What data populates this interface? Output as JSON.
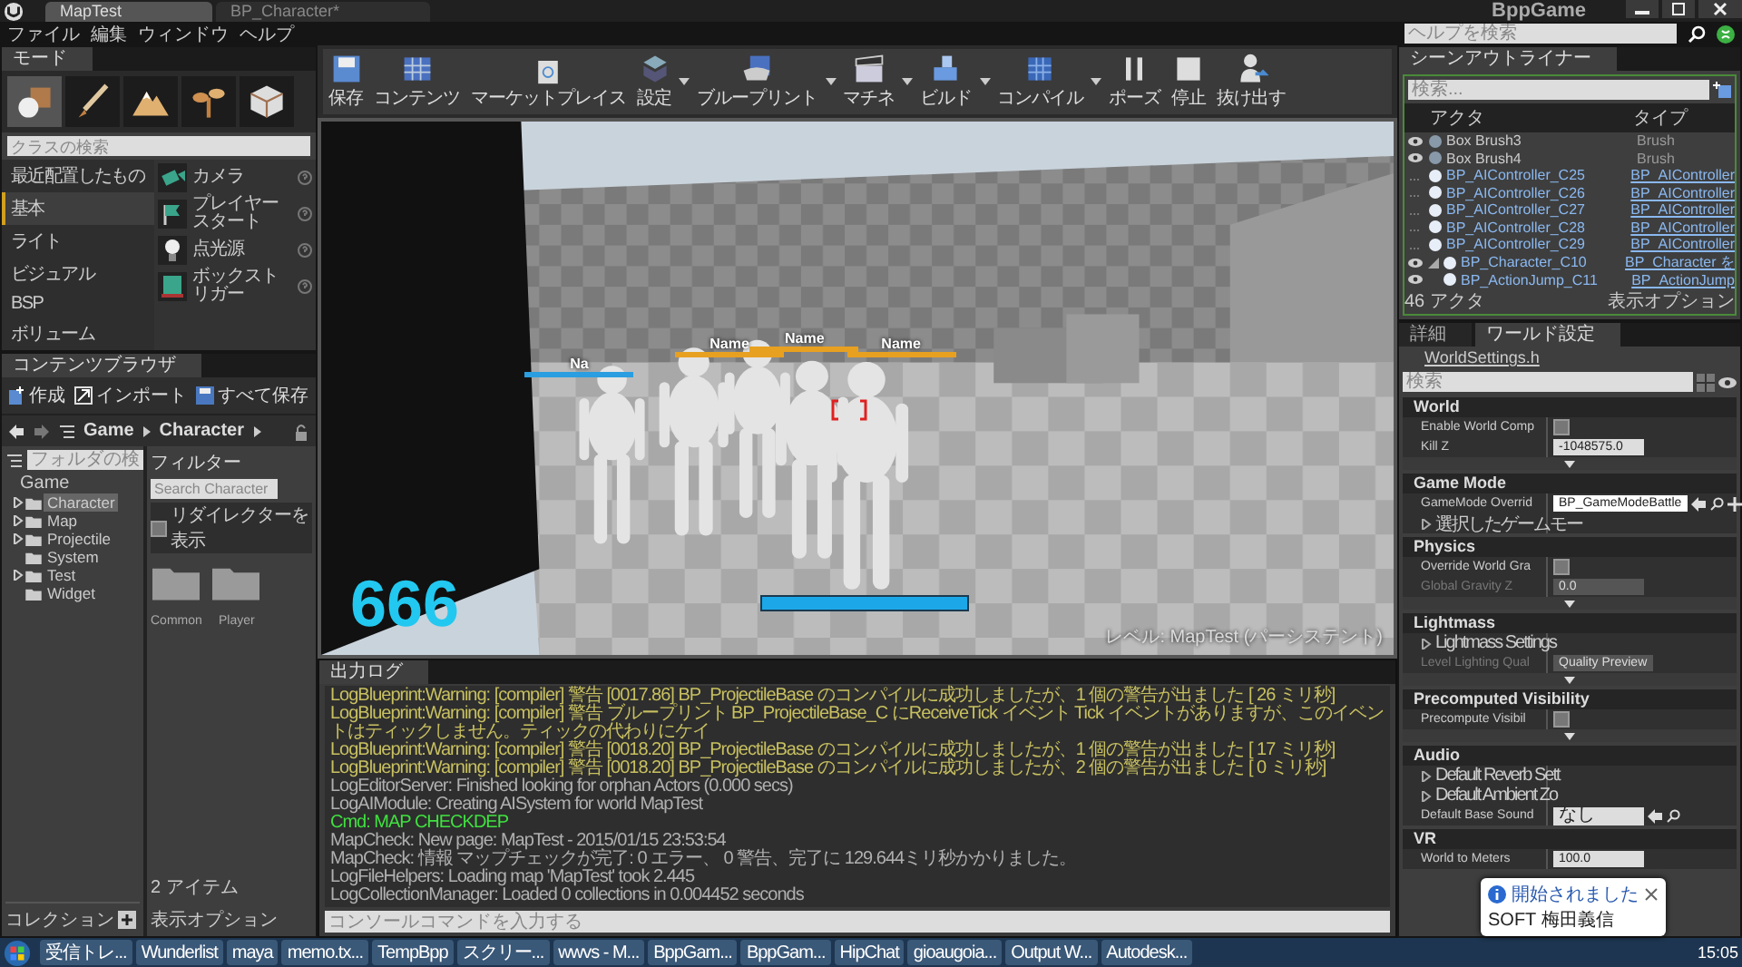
{
  "window": {
    "title": "BppGame",
    "tabs": [
      {
        "label": "MapTest",
        "selected": true
      },
      {
        "label": "BP_Character*",
        "selected": false
      }
    ]
  },
  "menu": [
    "ファイル",
    "編集",
    "ウィンドウ",
    "ヘルプ"
  ],
  "help_search": {
    "placeholder": "ヘルプを検索"
  },
  "modes": {
    "tab": "モード",
    "tools": [
      {
        "kind": "place",
        "selected": true
      },
      {
        "kind": "paint",
        "selected": false
      },
      {
        "kind": "landscape",
        "selected": false
      },
      {
        "kind": "foliage",
        "selected": false
      },
      {
        "kind": "geometry",
        "selected": false
      }
    ],
    "search": {
      "placeholder": "クラスの検索"
    },
    "categories": [
      {
        "label": "最近配置したもの",
        "selected": false
      },
      {
        "label": "基本",
        "selected": true
      },
      {
        "label": "ライト",
        "selected": false
      },
      {
        "label": "ビジュアル",
        "selected": false
      },
      {
        "label": "BSP",
        "selected": false
      },
      {
        "label": "ボリューム",
        "selected": false
      }
    ],
    "items": [
      {
        "kind": "camera",
        "label": "カメラ"
      },
      {
        "kind": "player_start",
        "label": "プレイヤースタート"
      },
      {
        "kind": "light",
        "label": "点光源"
      },
      {
        "kind": "trigger",
        "label": "ボックストリガー"
      }
    ]
  },
  "content_browser": {
    "tab": "コンテンツブラウザ",
    "actions": [
      {
        "kind": "create",
        "label": "作成"
      },
      {
        "kind": "import",
        "label": "インポート"
      },
      {
        "kind": "save",
        "label": "すべて保存"
      }
    ],
    "path": [
      "Game",
      "Character"
    ],
    "folder_search": {
      "placeholder": "フォルダの検"
    },
    "tree": [
      {
        "label": "Game",
        "selected": false,
        "children": [
          {
            "label": "Character",
            "selected": true,
            "expandable": true
          },
          {
            "label": "Map",
            "selected": false,
            "expandable": true
          },
          {
            "label": "Projectile",
            "selected": false,
            "expandable": true
          },
          {
            "label": "System",
            "selected": false,
            "expandable": false
          },
          {
            "label": "Test",
            "selected": false,
            "expandable": true
          },
          {
            "label": "Widget",
            "selected": false,
            "expandable": false
          }
        ]
      }
    ],
    "filter": "フィルター",
    "asset_search": {
      "placeholder": "Search Character"
    },
    "show_redirectors": {
      "label": "リダイレクターを表示",
      "checked": false
    },
    "folders": [
      "Common",
      "Player"
    ],
    "collections": "コレクション",
    "item_count": "2 アイテム",
    "view_options": "表示オプション"
  },
  "toolbar": [
    {
      "kind": "save",
      "label": "保存",
      "dropdown": false
    },
    {
      "kind": "content",
      "label": "コンテンツ",
      "dropdown": false
    },
    {
      "kind": "marketplace",
      "label": "マーケットプレイス",
      "dropdown": false
    },
    {
      "kind": "settings",
      "label": "設定",
      "dropdown": true
    },
    {
      "kind": "blueprint",
      "label": "ブループリント",
      "dropdown": true
    },
    {
      "kind": "matinee",
      "label": "マチネ",
      "dropdown": true
    },
    {
      "kind": "build",
      "label": "ビルド",
      "dropdown": true
    },
    {
      "kind": "compile",
      "label": "コンパイル",
      "dropdown": true
    },
    {
      "kind": "pause",
      "label": "ポーズ",
      "dropdown": false
    },
    {
      "kind": "stop",
      "label": "停止",
      "dropdown": false
    },
    {
      "kind": "eject",
      "label": "抜け出す",
      "dropdown": false
    }
  ],
  "viewport": {
    "score": "666",
    "name_tags": [
      {
        "label": "Na",
        "color": "#2a9ee0"
      },
      {
        "label": "Name",
        "color": "#e8a020"
      },
      {
        "label": "Name",
        "color": "#e8a020"
      },
      {
        "label": "Name",
        "color": "#e8a020"
      }
    ],
    "player_health": {
      "level": 1
    },
    "level_label": "レベル: MapTest (パーシステント)"
  },
  "output_log": {
    "tab": "出力ログ",
    "lines": [
      {
        "kind": "warning",
        "text": "LogBlueprint:Warning: [compiler] 警告 [0017.86] BP_ProjectileBase のコンパイルに成功しましたが、1 個の警告が出ました [ 26 ミリ秒]"
      },
      {
        "kind": "warning",
        "text": "LogBlueprint:Warning: [compiler] 警告 ブループリント BP_ProjectileBase_C にReceiveTick イベント Tick イベントがありますが、このイベントはティックしません。ティックの代わりにケイ"
      },
      {
        "kind": "warning",
        "text": "LogBlueprint:Warning: [compiler] 警告 [0018.20] BP_ProjectileBase のコンパイルに成功しましたが、1 個の警告が出ました [ 17 ミリ秒]"
      },
      {
        "kind": "warning",
        "text": "LogBlueprint:Warning: [compiler] 警告 [0018.20] BP_ProjectileBase のコンパイルに成功しましたが、2 個の警告が出ました [ 0 ミリ秒]"
      },
      {
        "kind": "info",
        "text": "LogEditorServer: Finished looking for orphan Actors (0.000 secs)"
      },
      {
        "kind": "info",
        "text": "LogAIModule: Creating AISystem for world MapTest"
      },
      {
        "kind": "command",
        "text": "Cmd: MAP CHECKDEP"
      },
      {
        "kind": "info",
        "text": "MapCheck: New page: MapTest - 2015/01/15 23:53:54"
      },
      {
        "kind": "info",
        "text": "MapCheck: 情報 マップチェックが完了: 0 エラー、 0 警告、完了に 129.644ミリ秒かかりました。"
      },
      {
        "kind": "info",
        "text": "LogFileHelpers: Loading map 'MapTest' took 2.445"
      },
      {
        "kind": "info",
        "text": "LogCollectionManager: Loaded 0 collections in 0.004452 seconds"
      }
    ],
    "console": {
      "placeholder": "コンソールコマンドを入力する"
    }
  },
  "outliner": {
    "tab": "シーンアウトライナー",
    "search": {
      "placeholder": "検索..."
    },
    "columns": [
      "アクタ",
      "タイプ"
    ],
    "rows": [
      {
        "name": "Box Brush3",
        "type": "Brush",
        "visible": true,
        "linked": false
      },
      {
        "name": "Box Brush4",
        "type": "Brush",
        "visible": true,
        "linked": false
      },
      {
        "name": "BP_AIController_C25",
        "type": "BP_AIController",
        "visible": false,
        "linked": true
      },
      {
        "name": "BP_AIController_C26",
        "type": "BP_AIController",
        "visible": false,
        "linked": true
      },
      {
        "name": "BP_AIController_C27",
        "type": "BP_AIController",
        "visible": false,
        "linked": true
      },
      {
        "name": "BP_AIController_C28",
        "type": "BP_AIController",
        "visible": false,
        "linked": true
      },
      {
        "name": "BP_AIController_C29",
        "type": "BP_AIController",
        "visible": false,
        "linked": true
      },
      {
        "name": "BP_Character_C10",
        "type": "BP_Character を",
        "visible": true,
        "linked": true,
        "children": [
          {
            "name": "BP_ActionJump_C11",
            "type": "BP_ActionJump",
            "visible": true,
            "linked": true
          }
        ]
      }
    ],
    "count": "46 アクタ",
    "view_options": "表示オプション"
  },
  "details": {
    "tabs": [
      {
        "label": "詳細",
        "selected": false
      },
      {
        "label": "ワールド設定",
        "selected": true
      }
    ],
    "source": "WorldSettings.h",
    "search": {
      "placeholder": "検索"
    },
    "sections": [
      {
        "title": "World",
        "advanced": true,
        "props": [
          {
            "kind": "checkbox",
            "label": "Enable World Comp",
            "checked": false
          },
          {
            "kind": "number",
            "label": "Kill Z",
            "value": "-1048575.0",
            "disabled": false
          }
        ]
      },
      {
        "title": "Game Mode",
        "advanced": false,
        "props": [
          {
            "kind": "class_picker",
            "label": "GameMode Overrid",
            "value": "BP_GameModeBattle",
            "disabled": false
          },
          {
            "kind": "group",
            "label": "選択したゲームモー"
          }
        ]
      },
      {
        "title": "Physics",
        "advanced": true,
        "props": [
          {
            "kind": "checkbox",
            "label": "Override World Gra",
            "checked": false
          },
          {
            "kind": "number",
            "label": "Global Gravity Z",
            "value": "0.0",
            "disabled": true
          }
        ]
      },
      {
        "title": "Lightmass",
        "advanced": true,
        "props": [
          {
            "kind": "group",
            "label": "Lightmass Settings"
          },
          {
            "kind": "dropdown",
            "label": "Level Lighting Qual",
            "value": "Quality Preview",
            "disabled": true
          }
        ]
      },
      {
        "title": "Precomputed Visibility",
        "advanced": true,
        "props": [
          {
            "kind": "checkbox",
            "label": "Precompute Visibil",
            "checked": false
          }
        ]
      },
      {
        "title": "Audio",
        "advanced": false,
        "props": [
          {
            "kind": "group",
            "label": "Default Reverb Sett"
          },
          {
            "kind": "group",
            "label": "Default Ambient Zo"
          },
          {
            "kind": "asset_picker",
            "label": "Default Base Sound",
            "value": "なし",
            "disabled": false
          }
        ]
      },
      {
        "title": "VR",
        "advanced": false,
        "props": [
          {
            "kind": "number",
            "label": "World to Meters",
            "value": "100.0",
            "disabled": false
          }
        ]
      }
    ]
  },
  "notification": {
    "title": "開始されました",
    "subtitle": "SOFT 梅田義信"
  },
  "taskbar": {
    "items": [
      "受信トレ...",
      "Wunderlist",
      "maya",
      "memo.tx...",
      "TempBpp",
      "スクリー...",
      "wwvs - M...",
      "BppGam...",
      "BppGam...",
      "HipChat",
      "gioaugoia...",
      "Output W...",
      "Autodesk..."
    ],
    "clock": "15:05"
  }
}
